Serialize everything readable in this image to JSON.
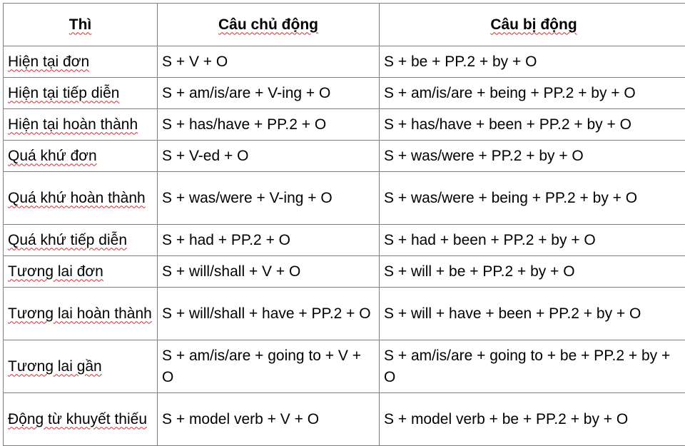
{
  "table": {
    "headers": [
      "Thì",
      "Câu chủ động",
      "Câu bị động"
    ],
    "rows": [
      {
        "tense": "Hiện tại đơn",
        "active": "S + V + O",
        "passive": "S + be + PP.2 + by + O"
      },
      {
        "tense": "Hiện tại tiếp diễn",
        "active": "S + am/is/are + V-ing + O",
        "passive": "S + am/is/are + being + PP.2 + by + O"
      },
      {
        "tense": "Hiện tại hoàn thành",
        "active": "S + has/have + PP.2 + O",
        "passive": "S + has/have + been + PP.2 + by + O"
      },
      {
        "tense": "Quá khứ đơn",
        "active": "S + V-ed + O",
        "passive": "S + was/were + PP.2 + by + O"
      },
      {
        "tense": "Quá khứ hoàn thành",
        "active": "S + was/were + V-ing + O",
        "passive": "S + was/were + being + PP.2 + by + O"
      },
      {
        "tense": "Quá khứ tiếp diễn",
        "active": "S + had + PP.2 + O",
        "passive": "S + had + been + PP.2 + by + O"
      },
      {
        "tense": "Tương lai đơn",
        "active": "S + will/shall + V + O",
        "passive": "S + will + be + PP.2 + by + O"
      },
      {
        "tense": "Tương lai hoàn thành",
        "active": "S + will/shall + have + PP.2 + O",
        "passive": "S + will + have + been + PP.2 + by + O"
      },
      {
        "tense": "Tương lai gần",
        "active": "S + am/is/are + going to + V + O",
        "passive": "S + am/is/are + going to + be + PP.2 + by + O"
      },
      {
        "tense": "Động từ khuyết thiếu",
        "active": "S + model verb + V + O",
        "passive": "S + model verb + be + PP.2 + by + O"
      }
    ]
  }
}
